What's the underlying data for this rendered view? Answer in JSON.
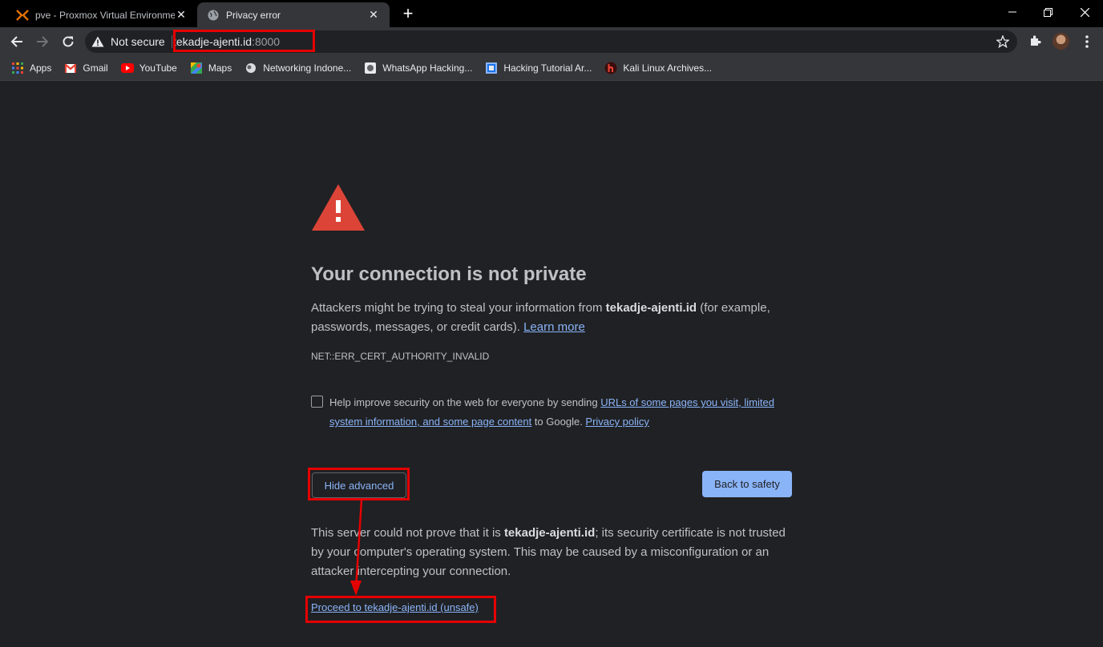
{
  "tabs": [
    {
      "title": "pve - Proxmox Virtual Environme",
      "favicon": "proxmox-icon",
      "active": false
    },
    {
      "title": "Privacy error",
      "favicon": "globe-icon",
      "active": true
    }
  ],
  "new_tab_label": "+",
  "toolbar": {
    "security_label": "Not secure",
    "url_host": "tekadje-ajenti.id",
    "url_port": ":8000"
  },
  "bookmarks": [
    {
      "label": "Apps",
      "icon": "apps-grid-icon"
    },
    {
      "label": "Gmail",
      "icon": "gmail-icon"
    },
    {
      "label": "YouTube",
      "icon": "youtube-icon"
    },
    {
      "label": "Maps",
      "icon": "maps-icon"
    },
    {
      "label": "Networking Indone...",
      "icon": "networking-icon"
    },
    {
      "label": "WhatsApp Hacking...",
      "icon": "whatsapp-hacking-icon"
    },
    {
      "label": "Hacking Tutorial Ar...",
      "icon": "hacking-tutorial-icon"
    },
    {
      "label": "Kali Linux Archives...",
      "icon": "kali-icon"
    }
  ],
  "page": {
    "heading": "Your connection is not private",
    "main_before": "Attackers might be trying to steal your information from ",
    "main_host": "tekadje-ajenti.id",
    "main_after": " (for example, passwords, messages, or credit cards). ",
    "learn_more": "Learn more",
    "error_code": "NET::ERR_CERT_AUTHORITY_INVALID",
    "optin_before": "Help improve security on the web for everyone by sending ",
    "optin_link": "URLs of some pages you visit, limited system information, and some page content",
    "optin_middle": " to Google. ",
    "privacy_policy": "Privacy policy",
    "hide_advanced": "Hide advanced",
    "back_to_safety": "Back to safety",
    "details_before": "This server could not prove that it is ",
    "details_host": "tekadje-ajenti.id",
    "details_after": "; its security certificate is not trusted by your computer's operating system. This may be caused by a misconfiguration or an attacker intercepting your connection.",
    "proceed_link": "Proceed to tekadje-ajenti.id (unsafe)"
  },
  "colors": {
    "annotation_red": "#e50000",
    "link_blue": "#8ab4f8",
    "warning_red": "#db4437"
  }
}
